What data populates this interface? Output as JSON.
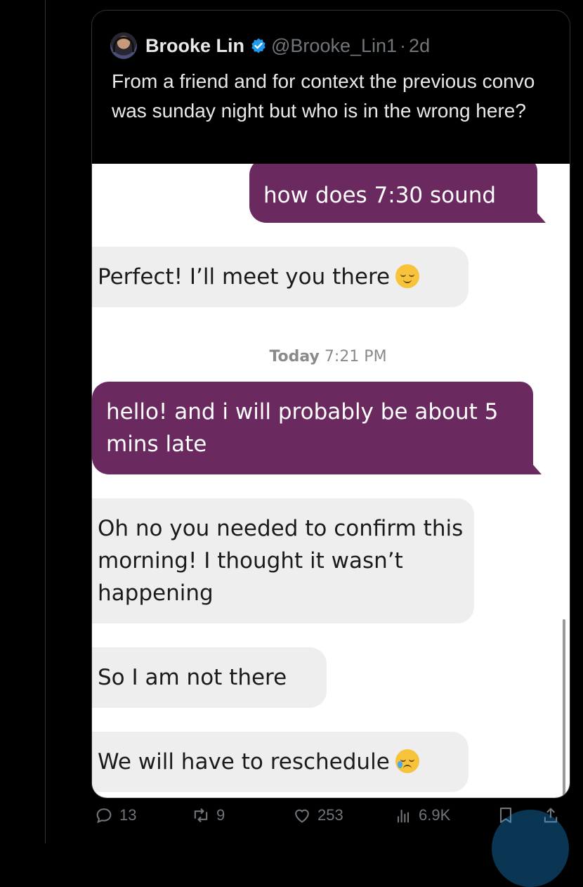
{
  "post": {
    "author_name": "Brooke Lin",
    "handle": "@Brooke_Lin1",
    "separator": "·",
    "age": "2d",
    "text": "From a friend and for context the previous convo was sunday night but who is in the wrong here?"
  },
  "chat": {
    "messages": [
      {
        "direction": "outgoing",
        "text": "how does 7:30 sound"
      },
      {
        "direction": "incoming",
        "text": "Perfect! I’ll meet you there",
        "emoji": "relieved-face"
      },
      {
        "direction": "outgoing",
        "text": "hello! and i will probably be about 5 mins late"
      },
      {
        "direction": "incoming",
        "text": "Oh no you needed to confirm this morning! I thought it wasn’t happening"
      },
      {
        "direction": "incoming",
        "text": "So I am not there"
      },
      {
        "direction": "incoming",
        "text": "We will have to reschedule",
        "emoji": "sad-but-relieved-face"
      }
    ],
    "timestamp": {
      "day": "Today",
      "time": "7:21 PM"
    },
    "colors": {
      "outgoing_bubble": "#6b2a5f",
      "incoming_bubble": "#eeeeee"
    }
  },
  "actions": {
    "replies": "13",
    "reposts": "9",
    "likes": "253",
    "views": "6.9K"
  },
  "colors": {
    "background": "#000000",
    "muted_text": "#71767b",
    "verified": "#1d9bf0"
  }
}
